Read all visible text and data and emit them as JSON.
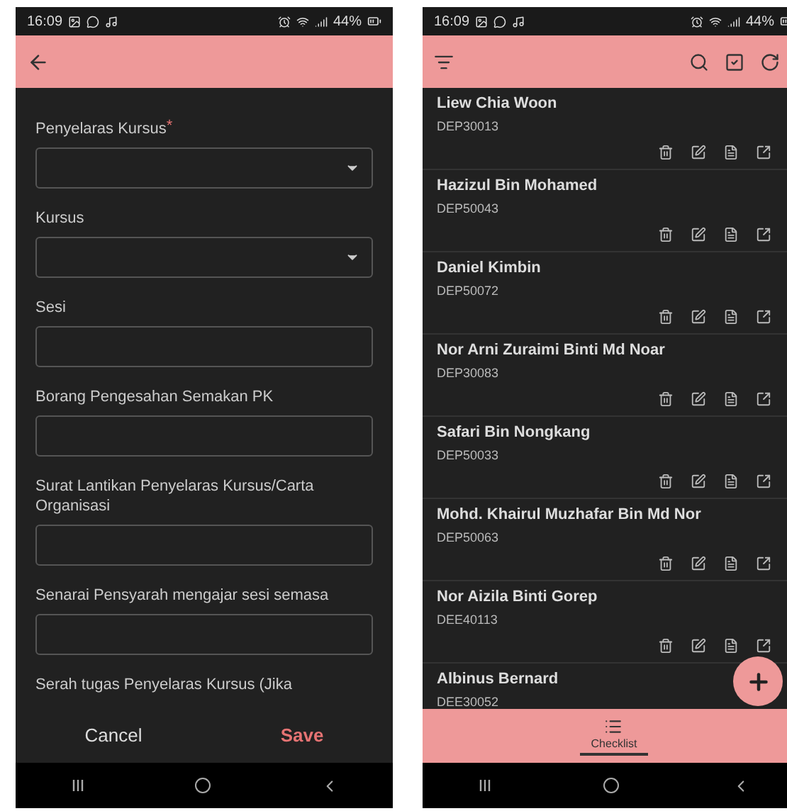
{
  "form_screen": {
    "status_bar": {
      "time": "16:09",
      "battery": "44%"
    },
    "fields": [
      {
        "label": "Penyelaras Kursus",
        "required_mark": "*",
        "kind": "dropdown"
      },
      {
        "label": "Kursus",
        "kind": "dropdown"
      },
      {
        "label": "Sesi",
        "kind": "text"
      },
      {
        "label": "Borang Pengesahan Semakan PK",
        "kind": "text"
      },
      {
        "label": "Surat Lantikan Penyelaras Kursus/Carta Organisasi",
        "kind": "text"
      },
      {
        "label": "Senarai Pensyarah mengajar sesi semasa",
        "kind": "text"
      },
      {
        "label": "Serah tugas Penyelaras Kursus (Jika",
        "kind": "cut"
      }
    ],
    "buttons": [
      {
        "label": "Cancel",
        "kind": "plain"
      },
      {
        "label": "Save",
        "kind": "primary"
      }
    ]
  },
  "list_screen": {
    "status_bar": {
      "time": "16:09",
      "battery": "44%"
    },
    "items": [
      {
        "name": "Liew Chia Woon",
        "code": "DEP30013"
      },
      {
        "name": "Hazizul Bin Mohamed",
        "code": "DEP50043"
      },
      {
        "name": "Daniel Kimbin",
        "code": "DEP50072"
      },
      {
        "name": "Nor Arni Zuraimi Binti Md Noar",
        "code": "DEP30083"
      },
      {
        "name": "Safari Bin Nongkang",
        "code": "DEP50033"
      },
      {
        "name": "Mohd. Khairul Muzhafar Bin Md Nor",
        "code": "DEP50063"
      },
      {
        "name": "Nor Aizila Binti Gorep",
        "code": "DEE40113"
      },
      {
        "name": "Albinus Bernard",
        "code": "DEE30052"
      }
    ],
    "bottom_tabs": [
      {
        "label": "Checklist",
        "selected": true
      }
    ]
  }
}
